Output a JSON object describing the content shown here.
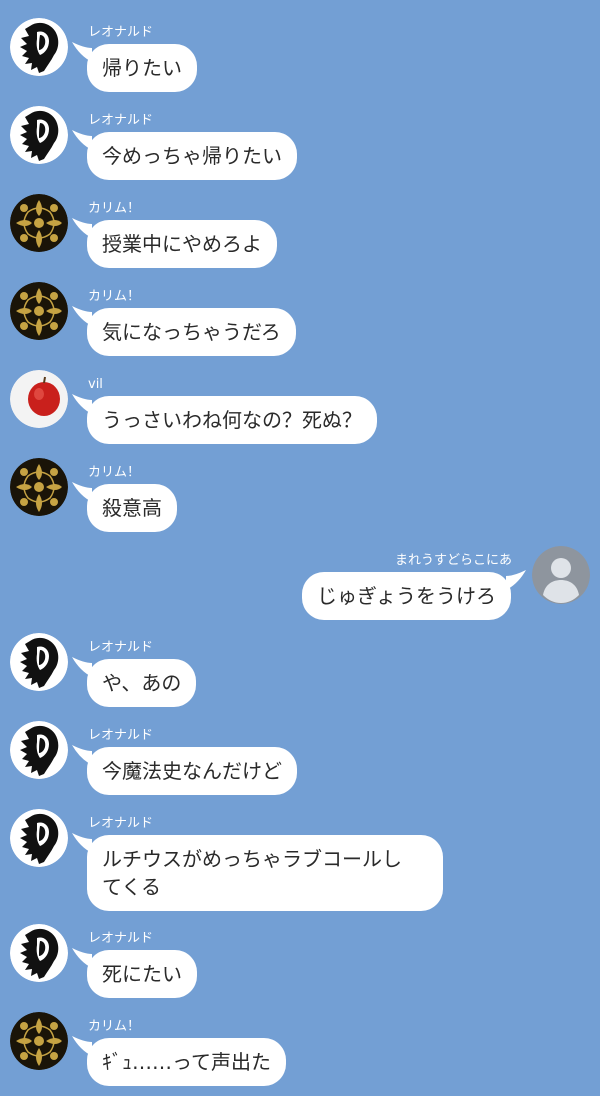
{
  "colors": {
    "background": "#739fd4",
    "bubble": "#ffffff",
    "text": "#2a2a2a",
    "name": "#ffffff"
  },
  "messages": [
    {
      "sender": "レオナルド",
      "avatar": "lion-avatar",
      "side": "left",
      "text": "帰りたい"
    },
    {
      "sender": "レオナルド",
      "avatar": "lion-avatar",
      "side": "left",
      "text": "今めっちゃ帰りたい"
    },
    {
      "sender": "カリム！",
      "avatar": "damask-avatar",
      "side": "left",
      "text": "授業中にやめろよ"
    },
    {
      "sender": "カリム！",
      "avatar": "damask-avatar",
      "side": "left",
      "text": "気になっちゃうだろ"
    },
    {
      "sender": "vil",
      "avatar": "apple-avatar",
      "side": "left",
      "text": "うっさいわね何なの？死ぬ？"
    },
    {
      "sender": "カリム！",
      "avatar": "damask-avatar",
      "side": "left",
      "text": "殺意高"
    },
    {
      "sender": "まれうすどらこにあ",
      "avatar": "default-user-avatar",
      "side": "right",
      "text": "じゅぎょうをうけろ"
    },
    {
      "sender": "レオナルド",
      "avatar": "lion-avatar",
      "side": "left",
      "text": "や、あの"
    },
    {
      "sender": "レオナルド",
      "avatar": "lion-avatar",
      "side": "left",
      "text": "今魔法史なんだけど"
    },
    {
      "sender": "レオナルド",
      "avatar": "lion-avatar",
      "side": "left",
      "text": "ルチウスがめっちゃラブコールし\nてくる"
    },
    {
      "sender": "レオナルド",
      "avatar": "lion-avatar",
      "side": "left",
      "text": "死にたい"
    },
    {
      "sender": "カリム！",
      "avatar": "damask-avatar",
      "side": "left",
      "text": "ｷﾞｭ……って声出た"
    }
  ]
}
